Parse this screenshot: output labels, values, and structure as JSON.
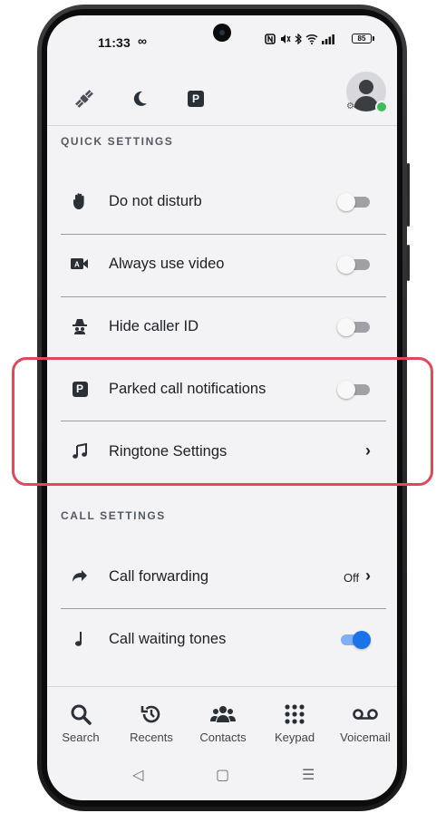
{
  "status_bar": {
    "time": "11:33",
    "infinity_glyph": "∞",
    "battery": "85"
  },
  "toolbar": {
    "icons": [
      "satellite-icon",
      "moon-icon",
      "park-icon"
    ],
    "park_glyph": "P"
  },
  "sections": {
    "quick_settings_title": "QUICK SETTINGS",
    "call_settings_title": "CALL SETTINGS"
  },
  "quick_settings": [
    {
      "label": "Do not disturb",
      "icon": "hand-icon",
      "control": "toggle",
      "on": false
    },
    {
      "label": "Always use video",
      "icon": "video-icon",
      "control": "toggle",
      "on": false
    },
    {
      "label": "Hide caller ID",
      "icon": "spy-icon",
      "control": "toggle",
      "on": false
    },
    {
      "label": "Parked call notifications",
      "icon": "park-icon",
      "control": "toggle",
      "on": false
    },
    {
      "label": "Ringtone Settings",
      "icon": "music-icon",
      "control": "chevron"
    }
  ],
  "call_settings": [
    {
      "label": "Call forwarding",
      "icon": "forward-icon",
      "control": "chevron",
      "value": "Off"
    },
    {
      "label": "Call waiting tones",
      "icon": "note-icon",
      "control": "toggle",
      "on": true
    }
  ],
  "bottom_nav": {
    "items": [
      {
        "label": "Search",
        "icon": "search-icon"
      },
      {
        "label": "Recents",
        "icon": "history-icon"
      },
      {
        "label": "Contacts",
        "icon": "contacts-icon"
      },
      {
        "label": "Keypad",
        "icon": "keypad-icon"
      },
      {
        "label": "Voicemail",
        "icon": "voicemail-icon"
      }
    ]
  },
  "system_nav": {
    "back": "◁",
    "home": "▢",
    "recents": "☰"
  },
  "colors": {
    "accent": "#1a73e8",
    "highlight": "#de4a5a",
    "presence": "#3dbd5a"
  }
}
